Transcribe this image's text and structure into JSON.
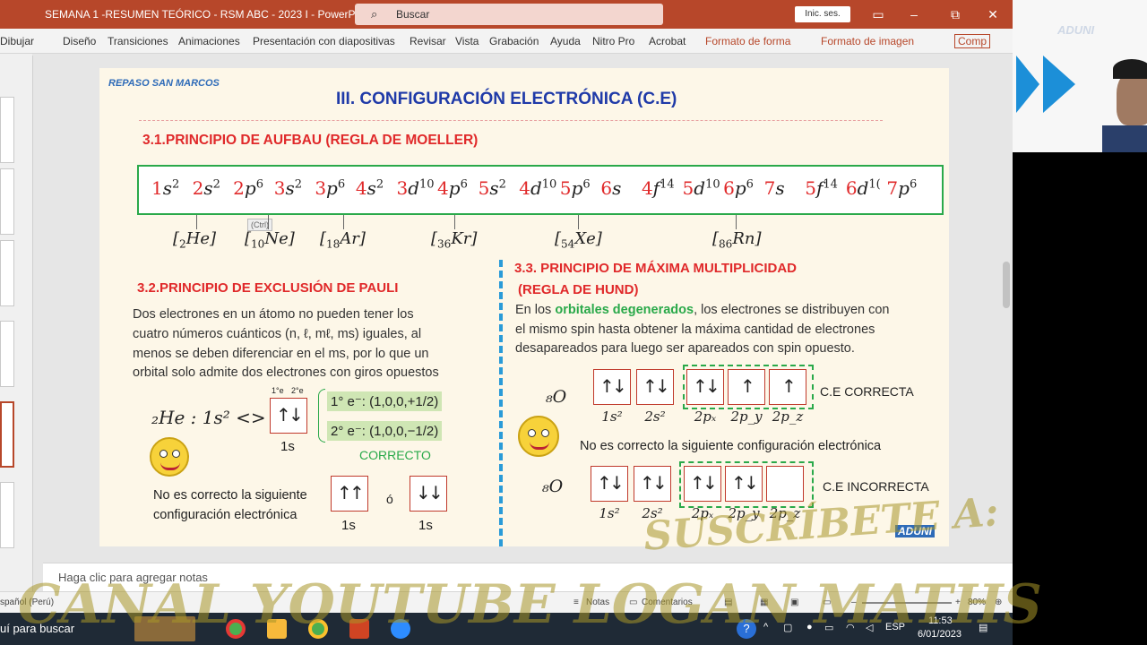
{
  "window": {
    "title": "SEMANA 1 -RESUMEN TEÓRICO - RSM ABC - 2023 I - PowerPoint",
    "search_placeholder": "Buscar",
    "signin_label": "Inic. ses.",
    "restore_symbol": "⧉",
    "close_symbol": "✕",
    "accent_color": "#b7472a"
  },
  "ribbon": {
    "tabs": [
      "Dibujar",
      "Diseño",
      "Transiciones",
      "Animaciones",
      "Presentación con diapositivas",
      "Revisar",
      "Vista",
      "Grabación",
      "Ayuda",
      "Nitro Pro",
      "Acrobat"
    ],
    "context_tabs": [
      "Formato de forma",
      "Formato de imagen"
    ],
    "comp_label": "Comp"
  },
  "slide": {
    "brand": "REPASO SAN MARCOS",
    "title": "III. CONFIGURACIÓN ELECTRÓNICA (C.E)",
    "aufbau": {
      "heading": "3.1.PRINCIPIO DE AUFBAU (REGLA DE MOELLER)",
      "sequence": [
        {
          "n": "1",
          "l": "s",
          "e": "2",
          "red": true
        },
        {
          "n": "2",
          "l": "s",
          "e": "2",
          "red": true
        },
        {
          "n": "2",
          "l": "p",
          "e": "6",
          "red": true
        },
        {
          "n": "3",
          "l": "s",
          "e": "2",
          "red": true
        },
        {
          "n": "3",
          "l": "p",
          "e": "6",
          "red": true
        },
        {
          "n": "4",
          "l": "s",
          "e": "2",
          "red": true
        },
        {
          "n": "3",
          "l": "d",
          "e": "10",
          "red": true
        },
        {
          "n": "4",
          "l": "p",
          "e": "6",
          "red": true
        },
        {
          "n": "5",
          "l": "s",
          "e": "2",
          "red": true
        },
        {
          "n": "4",
          "l": "d",
          "e": "10",
          "red": true
        },
        {
          "n": "5",
          "l": "p",
          "e": "6",
          "red": true
        },
        {
          "n": "6",
          "l": "s",
          "e": "",
          "red": true
        },
        {
          "n": "4",
          "l": "f",
          "e": "14",
          "red": true
        },
        {
          "n": "5",
          "l": "d",
          "e": "10",
          "red": true
        },
        {
          "n": "6",
          "l": "p",
          "e": "6",
          "red": true
        },
        {
          "n": "7",
          "l": "s",
          "e": "",
          "red": true
        },
        {
          "n": "5",
          "l": "f",
          "e": "14",
          "red": true
        },
        {
          "n": "6",
          "l": "d",
          "e": "1(",
          "red": true
        },
        {
          "n": "7",
          "l": "p",
          "e": "6",
          "red": true
        }
      ],
      "ctrl_tag": "(Ctrl)",
      "noble_gases": [
        {
          "sub": "2",
          "sym": "He"
        },
        {
          "sub": "10",
          "sym": "Ne"
        },
        {
          "sub": "18",
          "sym": "Ar"
        },
        {
          "sub": "36",
          "sym": "Kr"
        },
        {
          "sub": "54",
          "sym": "Xe"
        },
        {
          "sub": "86",
          "sym": "Rn"
        }
      ]
    },
    "pauli": {
      "heading": "3.2.PRINCIPIO DE EXCLUSIÓN DE PAULI",
      "body": "Dos electrones en un átomo no pueden tener los cuatro números cuánticos (n, ℓ, mℓ, ms) iguales, al menos se deben diferenciar en el ms, por lo que un orbital solo admite dos electrones con giros opuestos",
      "body_lines": [
        "Dos electrones en un átomo no pueden tener los",
        "cuatro números cuánticos (n, ℓ, mℓ, ms) iguales,  al",
        "menos se deben diferenciar en el ms, por lo que un",
        "orbital solo admite dos electrones con giros opuestos"
      ],
      "example": "₂He : 1s² <>",
      "spin_labels": [
        "1°e",
        "2°e"
      ],
      "orbital_label": "1s",
      "quantum_1": "1° e⁻: (1,0,0,+1/2)",
      "quantum_2": "2° e⁻: (1,0,0,−1/2)",
      "correct": "CORRECTO",
      "incorrect_note": "No es correcto la siguiente configuración electrónica",
      "incorrect_lines": [
        "No es correcto la siguiente",
        "configuración electrónica"
      ],
      "or_word": "ó"
    },
    "hund": {
      "heading": "3.3. PRINCIPIO DE MÁXIMA MULTIPLICIDAD",
      "heading2": "(REGLA DE HUND)",
      "body_pre": "En los ",
      "body_hl": "orbitales degenerados",
      "body_post": ", los electrones se distribuyen con",
      "body_lines": [
        "el mismo spin hasta obtener la máxima cantidad de electrones",
        "desapareados para luego ser apareados con spin opuesto."
      ],
      "element": "₈O",
      "sublevels": [
        "1s²",
        "2s²",
        "2pₓ",
        "2p_y",
        "2p_z"
      ],
      "correct_label": "C.E CORRECTA",
      "note": "No es correcto la siguiente configuración electrónica",
      "incorrect_label": "C.E INCORRECTA"
    },
    "logo": "ADUNI"
  },
  "notes_placeholder": "Haga clic para agregar notas",
  "status": {
    "language": "spañol (Perú)",
    "notes": "Notas",
    "comments": "Comentarios",
    "zoom": "80%"
  },
  "taskbar": {
    "search_text": "uí para buscar",
    "time": "11:53",
    "date": "6/01/2023",
    "lang": "ESP"
  },
  "watermark": {
    "line1": "SUSCRÍBETE A:",
    "line2": "CANAL YOUTUBE LOGAN MATHS"
  },
  "webcam": {
    "brand": "ADUNI"
  }
}
